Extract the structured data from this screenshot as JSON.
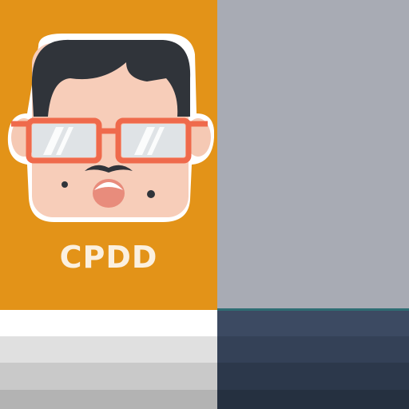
{
  "brand": {
    "name": "CPDD"
  },
  "colors": {
    "orange_panel": "#e39318",
    "gray_panel": "#a8abb4",
    "accent_line": "#2f6d73",
    "light_stripes": [
      "#ffffff",
      "#e0e0e0",
      "#c9c9c9",
      "#b3b3b3"
    ],
    "dark_stripes": [
      "#3c4a62",
      "#344157",
      "#2c384b",
      "#253040"
    ],
    "text": "#fbf0df"
  },
  "icons": {
    "avatar": "cartoon-face-with-glasses-icon"
  }
}
